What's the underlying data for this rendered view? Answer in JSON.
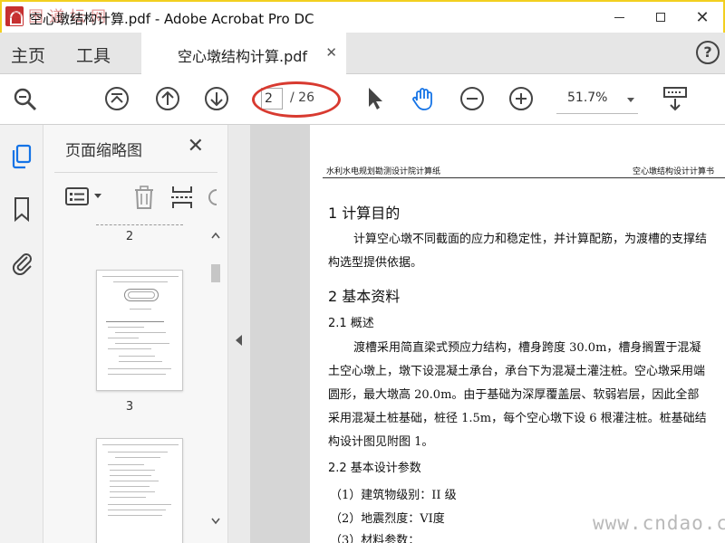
{
  "window": {
    "title": "空心墩结构计算.pdf - Adobe Acrobat Pro DC",
    "watermark_cn": "中国道坛网",
    "close_glyph": "✕"
  },
  "tabs": {
    "home": "主页",
    "tools": "工具",
    "document": "空心墩结构计算.pdf",
    "close_glyph": "✕",
    "help_glyph": "?"
  },
  "toolbar": {
    "current_page": "2",
    "total_pages": "/ 26",
    "zoom": "51.7%"
  },
  "thumbnails": {
    "title": "页面缩略图",
    "close_glyph": "✕",
    "pages": [
      "2",
      "3"
    ]
  },
  "document": {
    "header_left": "水利水电规划勘测设计院计算纸",
    "header_right": "空心墩结构设计计算书",
    "section1_title": "1  计算目的",
    "section1_text": "计算空心墩不同截面的应力和稳定性，并计算配筋，为渡槽的支撑结构选型提供依据。",
    "section2_title": "2  基本资料",
    "section21_title": "2.1  概述",
    "section21_text": "渡槽采用简直梁式预应力结构，槽身跨度 30.0m，槽身搁置于混凝土空心墩上，墩下设混凝土承台，承台下为混凝土灌注桩。空心墩采用端圆形，最大墩高 20.0m。由于基础为深厚覆盖层、软弱岩层，因此全部采用混凝土桩基础，桩径 1.5m，每个空心墩下设 6 根灌注桩。桩基础结构设计图见附图 1。",
    "section22_title": "2.2  基本设计参数",
    "param1": "（1）建筑物级别：II 级",
    "param2": "（2）地震烈度：VI度",
    "param3": "（3）材料参数："
  },
  "site_watermark": "www.cndao.com",
  "colors": {
    "accent_blue": "#1473e6",
    "annotation_red": "#d83a30",
    "title_border": "#f2cf1f"
  }
}
